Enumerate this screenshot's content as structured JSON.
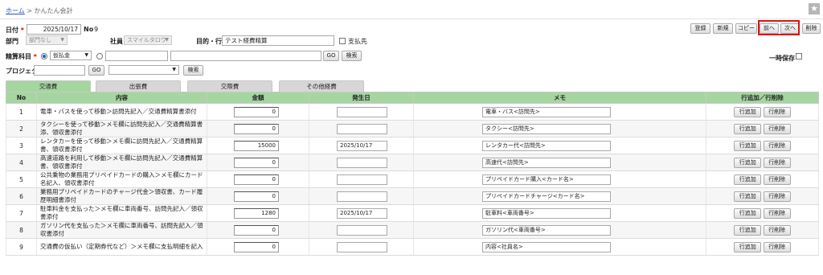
{
  "breadcrumb": {
    "home": "ホーム",
    "separator": ">",
    "current": "かんたん会計"
  },
  "header": {
    "date_label": "日付",
    "date_value": "2025/10/17",
    "no_label": "No",
    "no_value": "9",
    "dept_label": "部門",
    "dept_value": "部門なし",
    "employee_label": "社員",
    "employee_value": "スマイルタロウ",
    "purpose_label": "目的・行先",
    "purpose_value": "テスト経費精算",
    "payee_label": "支払先",
    "account_label": "精算科目",
    "account_value": "仮払金",
    "project_label": "プロジェクト",
    "temp_save_label": "一時保存"
  },
  "toolbar": {
    "register": "登録",
    "new": "新規",
    "copy": "コピー",
    "prev": "前へ",
    "next": "次へ",
    "delete": "削除",
    "go": "GO",
    "search": "検索"
  },
  "tabs": [
    {
      "label": "交通費"
    },
    {
      "label": "出張費"
    },
    {
      "label": "交際費"
    },
    {
      "label": "その他経費"
    }
  ],
  "table": {
    "headers": {
      "no": "No",
      "desc": "内容",
      "amount": "金額",
      "date": "発生日",
      "memo": "メモ",
      "ops": "行追加／行削除"
    },
    "add_label": "行追加",
    "del_label": "行削除",
    "rows": [
      {
        "no": "1",
        "desc": "電車・バスを使って移動＞訪問先記入／交通費精算書添付",
        "amount": "0",
        "date": "",
        "memo": "電車・バス<訪問先>"
      },
      {
        "no": "2",
        "desc": "タクシーを使って移動＞メモ欄に訪問先記入／交通費精算書添、領収書添付",
        "amount": "0",
        "date": "",
        "memo": "タクシー<訪問先>"
      },
      {
        "no": "3",
        "desc": "レンタカーを使って移動＞メモ欄に訪問先記入／交通費精算書、領収書添付",
        "amount": "15000",
        "date": "2025/10/17",
        "memo": "レンタカー代<訪問先>"
      },
      {
        "no": "4",
        "desc": "高速道路を利用して移動＞メモ欄に訪問先記入／交通費精算書、領収書添付",
        "amount": "0",
        "date": "",
        "memo": "高速代<訪問先>"
      },
      {
        "no": "5",
        "desc": "公共乗物の業務用プリペイドカードの購入＞メモ欄にカード名記入、領収書添付",
        "amount": "0",
        "date": "",
        "memo": "プリペイドカード購入<カード名>"
      },
      {
        "no": "6",
        "desc": "業務用プリペイドカードのチャージ代金＞領収書、カード履歴明細書添付",
        "amount": "0",
        "date": "",
        "memo": "プリペイドカードチャージ<カード名>"
      },
      {
        "no": "7",
        "desc": "駐車料金を支払った＞メモ欄に車両番号、訪問先記入／領収書添付",
        "amount": "1280",
        "date": "2025/10/17",
        "memo": "駐車料<車両番号>"
      },
      {
        "no": "8",
        "desc": "ガソリン代を支払った＞メモ欄に車両番号、訪問先記入／領収書添付",
        "amount": "0",
        "date": "",
        "memo": "ガソリン代<車両番号>"
      },
      {
        "no": "9",
        "desc": "交通費の仮払い（定期券代など）＞メモ欄に支払明細を記入",
        "amount": "0",
        "date": "",
        "memo": "内容<社員名>"
      }
    ]
  }
}
